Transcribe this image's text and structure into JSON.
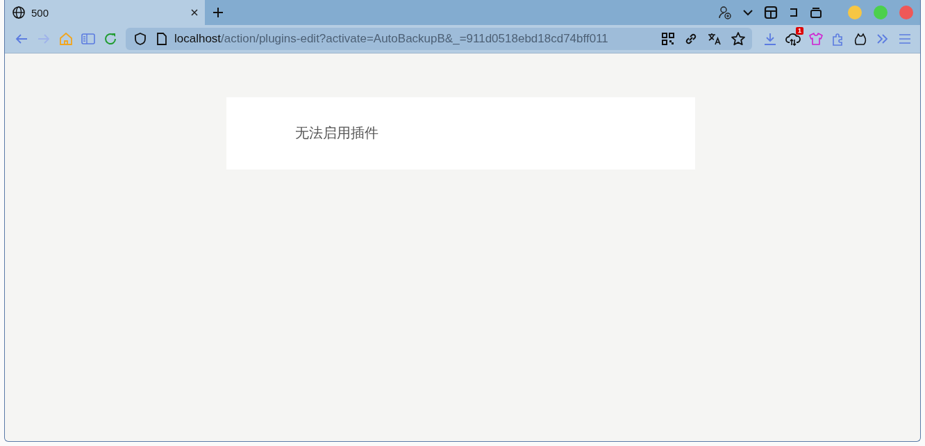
{
  "tabs": [
    {
      "title": "500",
      "selected": true
    }
  ],
  "address_bar": {
    "host": "localhost",
    "path": "/action/plugins-edit?activate=AutoBackupB&_=911d0518ebd18cd74bff011"
  },
  "extension_badge": "1",
  "page": {
    "message": "无法启用插件"
  }
}
